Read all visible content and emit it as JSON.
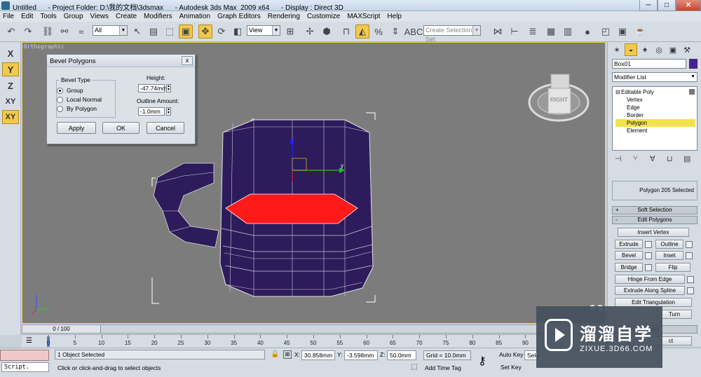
{
  "window": {
    "title": "Untitled      - Project Folder: D:\\我的文档\\3dsmax      - Autodesk 3ds Max  2009 x64      - Display : Direct 3D",
    "min_label": "─",
    "max_label": "□",
    "close_label": "✕"
  },
  "menu": [
    "File",
    "Edit",
    "Tools",
    "Group",
    "Views",
    "Create",
    "Modifiers",
    "Animation",
    "Graph Editors",
    "Rendering",
    "Customize",
    "MAXScript",
    "Help"
  ],
  "toolbar": {
    "filter_value": "All",
    "refcoord_value": "View",
    "named_selection_placeholder": "Create Selection Set",
    "active_tool": "select-and-move",
    "active_snap": "angle-snap"
  },
  "axes": {
    "x": "X",
    "y": "Y",
    "z": "Z",
    "xy": "XY",
    "xy2": "XY",
    "active": [
      "y",
      "xy2"
    ]
  },
  "viewport": {
    "label": "Orthographic",
    "viewcube_label": "RIGHT",
    "gizmo_y_label": "y",
    "selection_fill_color": "#ff1a1a",
    "mesh_color": "#2e1b5c"
  },
  "dialog": {
    "title": "Bevel Polygons",
    "close_label": "x",
    "group_label": "Bevel Type",
    "options": [
      "Group",
      "Local Normal",
      "By Polygon"
    ],
    "selected_option": "Group",
    "height_label": "Height:",
    "height_value": "-47.74mm",
    "outline_label": "Outline Amount:",
    "outline_value": "-1.0mm",
    "apply_label": "Apply",
    "ok_label": "OK",
    "cancel_label": "Cancel"
  },
  "command_panel": {
    "object_name": "Box01",
    "object_color": "#4a1e9e",
    "modifier_list_label": "Modifier List",
    "stack": [
      "Editable Poly",
      "Vertex",
      "Edge",
      "Border",
      "Polygon",
      "Element"
    ],
    "stack_selected": "Polygon",
    "selection_info": "Polygon 205 Selected",
    "rollouts": {
      "soft_selection": "Soft Selection",
      "soft_selection_toggle": "+",
      "edit_polygons": "Edit Polygons",
      "edit_polygons_toggle": "-",
      "geometry_tail": "etry",
      "last_row_tail": "ct"
    },
    "buttons": {
      "insert_vertex": "Insert Vertex",
      "extrude": "Extrude",
      "outline": "Outline",
      "bevel": "Bevel",
      "inset": "Inset",
      "bridge": "Bridge",
      "flip": "Flip",
      "hinge_from_edge": "Hinge From Edge",
      "extrude_along_spline": "Extrude Along Spline",
      "edit_triangulation": "Edit Triangulation",
      "turn": "Turn"
    }
  },
  "timeline": {
    "frame_display": "0 / 100",
    "ticks": [
      "0",
      "5",
      "10",
      "15",
      "20",
      "25",
      "30",
      "35",
      "40",
      "45",
      "50",
      "55",
      "60",
      "65",
      "70",
      "75",
      "80",
      "85",
      "90"
    ]
  },
  "status": {
    "script_label": "Script.",
    "selection_status": "1 Object Selected",
    "prompt": "Click or click-and-drag to select objects",
    "x_label": "X:",
    "x_value": "30.858mm",
    "y_label": "Y:",
    "y_value": "-3.598mm",
    "z_label": "Z:",
    "z_value": "50.0mm",
    "grid": "Grid = 10.0mm",
    "add_time_tag": "Add Time Tag",
    "auto_key": "Auto Key",
    "set_key": "Set Key",
    "selected_partial": "Sele"
  },
  "watermark": {
    "title": "溜溜自学",
    "subtitle": "ZIXUE.3D66.COM"
  }
}
